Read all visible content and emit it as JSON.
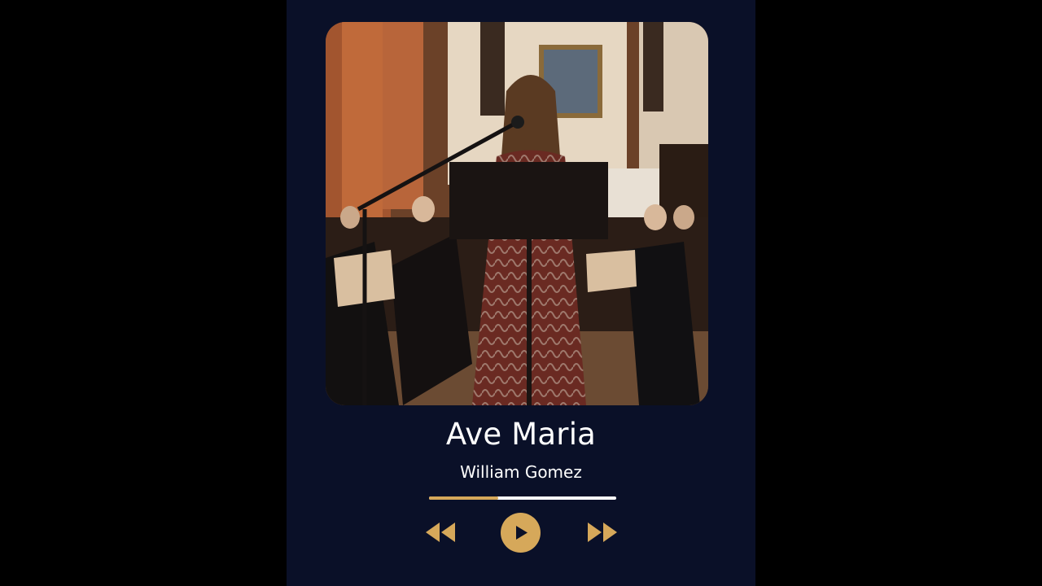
{
  "track": {
    "title": "Ave Maria",
    "artist": "William Gomez",
    "progress_fraction": 0.37
  },
  "artwork": {
    "description_icon": "album-artwork-image"
  },
  "controls": {
    "rewind_icon": "rewind-icon",
    "play_icon": "play-icon",
    "forward_icon": "fast-forward-icon"
  },
  "colors": {
    "background": "#000000",
    "card": "#0a1028",
    "accent": "#d6a85a",
    "text": "#ffffff"
  }
}
